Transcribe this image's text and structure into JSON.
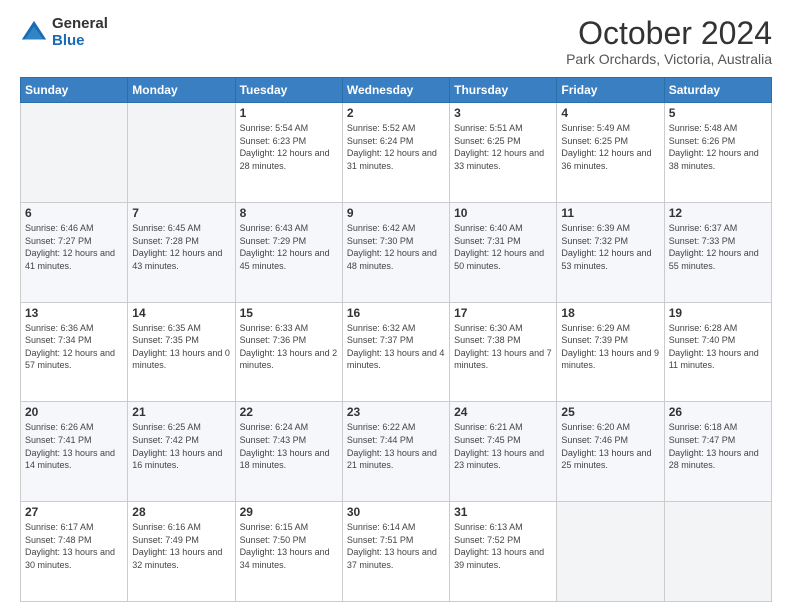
{
  "header": {
    "logo_general": "General",
    "logo_blue": "Blue",
    "title": "October 2024",
    "subtitle": "Park Orchards, Victoria, Australia"
  },
  "days_of_week": [
    "Sunday",
    "Monday",
    "Tuesday",
    "Wednesday",
    "Thursday",
    "Friday",
    "Saturday"
  ],
  "weeks": [
    [
      {
        "day": "",
        "sunrise": "",
        "sunset": "",
        "daylight": ""
      },
      {
        "day": "",
        "sunrise": "",
        "sunset": "",
        "daylight": ""
      },
      {
        "day": "1",
        "sunrise": "Sunrise: 5:54 AM",
        "sunset": "Sunset: 6:23 PM",
        "daylight": "Daylight: 12 hours and 28 minutes."
      },
      {
        "day": "2",
        "sunrise": "Sunrise: 5:52 AM",
        "sunset": "Sunset: 6:24 PM",
        "daylight": "Daylight: 12 hours and 31 minutes."
      },
      {
        "day": "3",
        "sunrise": "Sunrise: 5:51 AM",
        "sunset": "Sunset: 6:25 PM",
        "daylight": "Daylight: 12 hours and 33 minutes."
      },
      {
        "day": "4",
        "sunrise": "Sunrise: 5:49 AM",
        "sunset": "Sunset: 6:25 PM",
        "daylight": "Daylight: 12 hours and 36 minutes."
      },
      {
        "day": "5",
        "sunrise": "Sunrise: 5:48 AM",
        "sunset": "Sunset: 6:26 PM",
        "daylight": "Daylight: 12 hours and 38 minutes."
      }
    ],
    [
      {
        "day": "6",
        "sunrise": "Sunrise: 6:46 AM",
        "sunset": "Sunset: 7:27 PM",
        "daylight": "Daylight: 12 hours and 41 minutes."
      },
      {
        "day": "7",
        "sunrise": "Sunrise: 6:45 AM",
        "sunset": "Sunset: 7:28 PM",
        "daylight": "Daylight: 12 hours and 43 minutes."
      },
      {
        "day": "8",
        "sunrise": "Sunrise: 6:43 AM",
        "sunset": "Sunset: 7:29 PM",
        "daylight": "Daylight: 12 hours and 45 minutes."
      },
      {
        "day": "9",
        "sunrise": "Sunrise: 6:42 AM",
        "sunset": "Sunset: 7:30 PM",
        "daylight": "Daylight: 12 hours and 48 minutes."
      },
      {
        "day": "10",
        "sunrise": "Sunrise: 6:40 AM",
        "sunset": "Sunset: 7:31 PM",
        "daylight": "Daylight: 12 hours and 50 minutes."
      },
      {
        "day": "11",
        "sunrise": "Sunrise: 6:39 AM",
        "sunset": "Sunset: 7:32 PM",
        "daylight": "Daylight: 12 hours and 53 minutes."
      },
      {
        "day": "12",
        "sunrise": "Sunrise: 6:37 AM",
        "sunset": "Sunset: 7:33 PM",
        "daylight": "Daylight: 12 hours and 55 minutes."
      }
    ],
    [
      {
        "day": "13",
        "sunrise": "Sunrise: 6:36 AM",
        "sunset": "Sunset: 7:34 PM",
        "daylight": "Daylight: 12 hours and 57 minutes."
      },
      {
        "day": "14",
        "sunrise": "Sunrise: 6:35 AM",
        "sunset": "Sunset: 7:35 PM",
        "daylight": "Daylight: 13 hours and 0 minutes."
      },
      {
        "day": "15",
        "sunrise": "Sunrise: 6:33 AM",
        "sunset": "Sunset: 7:36 PM",
        "daylight": "Daylight: 13 hours and 2 minutes."
      },
      {
        "day": "16",
        "sunrise": "Sunrise: 6:32 AM",
        "sunset": "Sunset: 7:37 PM",
        "daylight": "Daylight: 13 hours and 4 minutes."
      },
      {
        "day": "17",
        "sunrise": "Sunrise: 6:30 AM",
        "sunset": "Sunset: 7:38 PM",
        "daylight": "Daylight: 13 hours and 7 minutes."
      },
      {
        "day": "18",
        "sunrise": "Sunrise: 6:29 AM",
        "sunset": "Sunset: 7:39 PM",
        "daylight": "Daylight: 13 hours and 9 minutes."
      },
      {
        "day": "19",
        "sunrise": "Sunrise: 6:28 AM",
        "sunset": "Sunset: 7:40 PM",
        "daylight": "Daylight: 13 hours and 11 minutes."
      }
    ],
    [
      {
        "day": "20",
        "sunrise": "Sunrise: 6:26 AM",
        "sunset": "Sunset: 7:41 PM",
        "daylight": "Daylight: 13 hours and 14 minutes."
      },
      {
        "day": "21",
        "sunrise": "Sunrise: 6:25 AM",
        "sunset": "Sunset: 7:42 PM",
        "daylight": "Daylight: 13 hours and 16 minutes."
      },
      {
        "day": "22",
        "sunrise": "Sunrise: 6:24 AM",
        "sunset": "Sunset: 7:43 PM",
        "daylight": "Daylight: 13 hours and 18 minutes."
      },
      {
        "day": "23",
        "sunrise": "Sunrise: 6:22 AM",
        "sunset": "Sunset: 7:44 PM",
        "daylight": "Daylight: 13 hours and 21 minutes."
      },
      {
        "day": "24",
        "sunrise": "Sunrise: 6:21 AM",
        "sunset": "Sunset: 7:45 PM",
        "daylight": "Daylight: 13 hours and 23 minutes."
      },
      {
        "day": "25",
        "sunrise": "Sunrise: 6:20 AM",
        "sunset": "Sunset: 7:46 PM",
        "daylight": "Daylight: 13 hours and 25 minutes."
      },
      {
        "day": "26",
        "sunrise": "Sunrise: 6:18 AM",
        "sunset": "Sunset: 7:47 PM",
        "daylight": "Daylight: 13 hours and 28 minutes."
      }
    ],
    [
      {
        "day": "27",
        "sunrise": "Sunrise: 6:17 AM",
        "sunset": "Sunset: 7:48 PM",
        "daylight": "Daylight: 13 hours and 30 minutes."
      },
      {
        "day": "28",
        "sunrise": "Sunrise: 6:16 AM",
        "sunset": "Sunset: 7:49 PM",
        "daylight": "Daylight: 13 hours and 32 minutes."
      },
      {
        "day": "29",
        "sunrise": "Sunrise: 6:15 AM",
        "sunset": "Sunset: 7:50 PM",
        "daylight": "Daylight: 13 hours and 34 minutes."
      },
      {
        "day": "30",
        "sunrise": "Sunrise: 6:14 AM",
        "sunset": "Sunset: 7:51 PM",
        "daylight": "Daylight: 13 hours and 37 minutes."
      },
      {
        "day": "31",
        "sunrise": "Sunrise: 6:13 AM",
        "sunset": "Sunset: 7:52 PM",
        "daylight": "Daylight: 13 hours and 39 minutes."
      },
      {
        "day": "",
        "sunrise": "",
        "sunset": "",
        "daylight": ""
      },
      {
        "day": "",
        "sunrise": "",
        "sunset": "",
        "daylight": ""
      }
    ]
  ]
}
